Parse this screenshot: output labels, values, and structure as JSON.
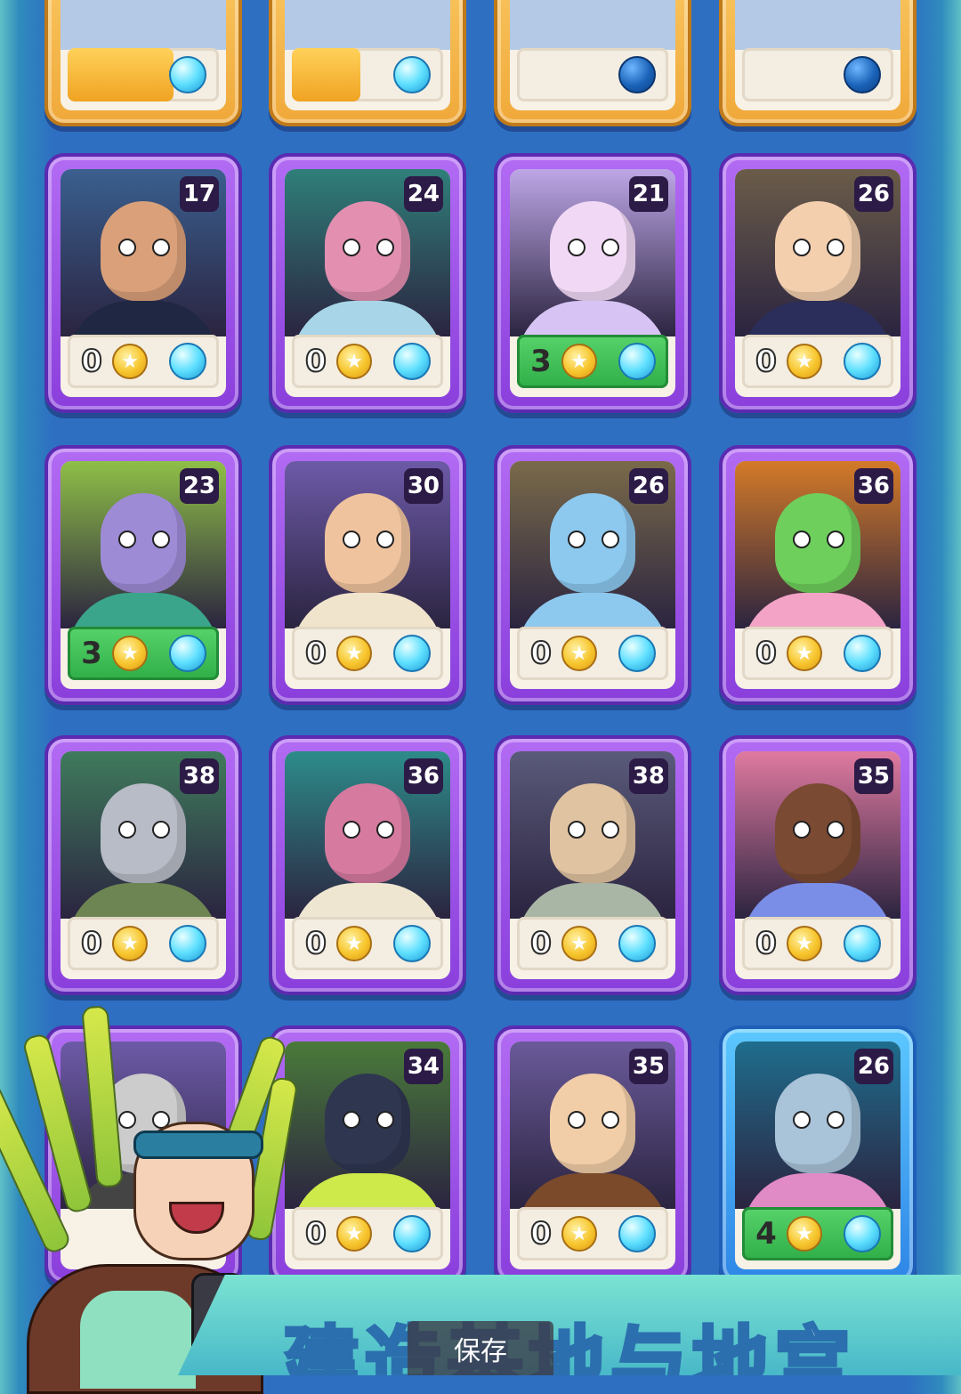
{
  "colors": {
    "background": "#2e6fc2",
    "card_purple": "#9b4fe8",
    "card_blue": "#3a9cf0",
    "card_gold": "#f4b94a",
    "active_bar": "#3cc257",
    "level_badge": "#2c1b46"
  },
  "top_row_cards": [
    {
      "frame": "gold",
      "progress": 0.7,
      "orb": "light"
    },
    {
      "frame": "gold",
      "progress": 0.45,
      "orb": "light"
    },
    {
      "frame": "gold",
      "progress": 0,
      "orb": "dark"
    },
    {
      "frame": "gold",
      "progress": 0,
      "orb": "dark"
    }
  ],
  "cards": [
    {
      "level": "17",
      "count": "0",
      "active": false,
      "frame": "purple",
      "skin": "#d9a07a",
      "bg": "#3a5f8f",
      "outfit": "#1f2742",
      "desc": "shouting-officer"
    },
    {
      "level": "24",
      "count": "0",
      "active": false,
      "frame": "purple",
      "skin": "#e28fb0",
      "bg": "#2f7f7a",
      "outfit": "#a8d6e8",
      "desc": "pink-alien-gentleman"
    },
    {
      "level": "21",
      "count": "3",
      "active": true,
      "frame": "purple",
      "skin": "#f1d9f5",
      "bg": "#bda6e6",
      "outfit": "#d7c4f4",
      "desc": "crystal-creature"
    },
    {
      "level": "26",
      "count": "0",
      "active": false,
      "frame": "purple",
      "skin": "#f3cfae",
      "bg": "#6b5c49",
      "outfit": "#2b2d5a",
      "desc": "sunglasses-blonde"
    },
    {
      "level": "23",
      "count": "3",
      "active": true,
      "frame": "purple",
      "skin": "#9e8bd6",
      "bg": "#8fbf47",
      "outfit": "#3aa58b",
      "desc": "purple-raptor"
    },
    {
      "level": "30",
      "count": "0",
      "active": false,
      "frame": "purple",
      "skin": "#f0c39f",
      "bg": "#6d5aa8",
      "outfit": "#f1e4cc",
      "desc": "smiling-old-man"
    },
    {
      "level": "26",
      "count": "0",
      "active": false,
      "frame": "purple",
      "skin": "#8dc8ee",
      "bg": "#7a6a4a",
      "outfit": "#8dc8ee",
      "desc": "blue-fluffy-critter"
    },
    {
      "level": "36",
      "count": "0",
      "active": false,
      "frame": "purple",
      "skin": "#6ecf5c",
      "bg": "#d47a28",
      "outfit": "#f2a3c6",
      "desc": "green-alien-suit"
    },
    {
      "level": "38",
      "count": "0",
      "active": false,
      "frame": "purple",
      "skin": "#b7bcc6",
      "bg": "#3f7b5c",
      "outfit": "#6d8552",
      "desc": "robot-soldier"
    },
    {
      "level": "36",
      "count": "0",
      "active": false,
      "frame": "purple",
      "skin": "#d67aa0",
      "bg": "#2d8c8a",
      "outfit": "#efe6d2",
      "desc": "pink-dragon"
    },
    {
      "level": "38",
      "count": "0",
      "active": false,
      "frame": "purple",
      "skin": "#e0c3a1",
      "bg": "#5a5a7a",
      "outfit": "#a9b6a6",
      "desc": "bearded-wizard"
    },
    {
      "level": "35",
      "count": "0",
      "active": false,
      "frame": "purple",
      "skin": "#7a4a32",
      "bg": "#e07aa0",
      "outfit": "#7a8ee8",
      "desc": "star-afro-woman"
    },
    {
      "level": "",
      "count": "",
      "active": false,
      "frame": "purple",
      "skin": "#ccc",
      "bg": "#6d5aa8",
      "outfit": "#444",
      "desc": "hidden-card"
    },
    {
      "level": "34",
      "count": "0",
      "active": false,
      "frame": "purple",
      "skin": "#2f3650",
      "bg": "#4a7a3a",
      "outfit": "#cde94a",
      "desc": "dark-serpent"
    },
    {
      "level": "35",
      "count": "0",
      "active": false,
      "frame": "purple",
      "skin": "#f1cda8",
      "bg": "#6a5a9a",
      "outfit": "#7a4a2a",
      "desc": "young-man-brown-hair"
    },
    {
      "level": "26",
      "count": "4",
      "active": true,
      "frame": "blue",
      "skin": "#a9c3d9",
      "bg": "#1f6d8d",
      "outfit": "#e08ac6",
      "desc": "robot-chef"
    }
  ],
  "banner": {
    "text": "建造基地与地宫"
  },
  "save_button": {
    "label": "保存"
  }
}
